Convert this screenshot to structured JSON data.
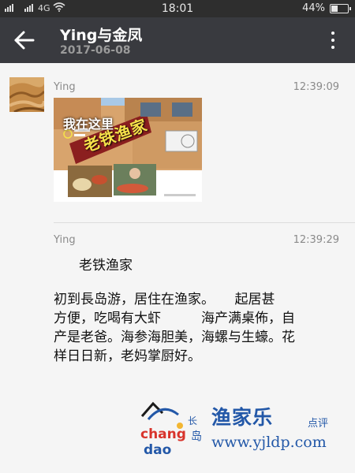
{
  "status_bar": {
    "signal_text": "4G",
    "time": "18:01",
    "battery_percent": "44%",
    "battery_level": 0.44
  },
  "header": {
    "title": "Ying与金凤",
    "subtitle": "2017-06-08"
  },
  "messages": [
    {
      "sender": "Ying",
      "time": "12:39:09",
      "type": "image",
      "image": {
        "overlay_title": "我在这里",
        "sign_text": "老铁渔家"
      }
    },
    {
      "sender": "Ying",
      "time": "12:39:29",
      "type": "text",
      "title": "老铁渔家",
      "lines": [
        "初到長岛游，居住在渔家。　　起居甚",
        "方便，吃喝有大虾　　　海产满桌佈，自",
        "产是老爸。海参海胆美，海螺与生蠔。花",
        "样日日新，老妈掌厨好。"
      ]
    }
  ],
  "watermark": {
    "logo_text": "changdao",
    "name": "渔家乐",
    "rate": "点评",
    "url": "www.yjldp.com"
  },
  "colors": {
    "header_bg": "#393a3f",
    "status_bg": "#2e2e2e",
    "body_bg": "#f5f5f5",
    "watermark": "#2358a8"
  }
}
